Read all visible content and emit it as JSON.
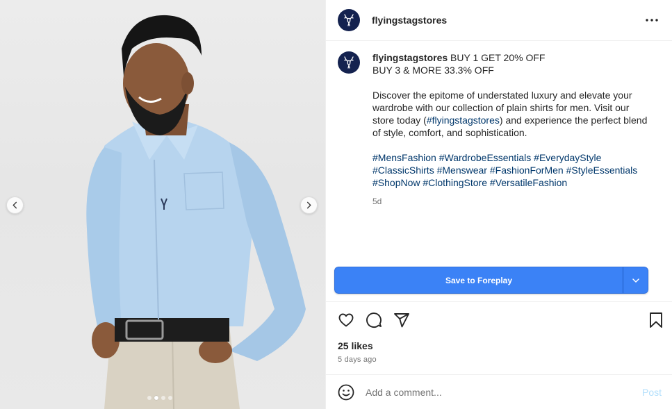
{
  "post": {
    "username": "flyingstagstores",
    "caption": {
      "line1": "BUY 1 GET 20% OFF",
      "line2": "BUY 3 & MORE 33.3% OFF",
      "body_before_tag": "Discover the epitome of understated luxury and elevate your wardrobe with our collection of plain shirts for men. Visit our store today (",
      "inline_tag": "#flyingstagstores",
      "body_after_tag": ") and experience the perfect blend of style, comfort, and sophistication.",
      "hashtags": [
        "#MensFashion",
        "#WardrobeEssentials",
        "#EverydayStyle",
        "#ClassicShirts",
        "#Menswear",
        "#FashionForMen",
        "#StyleEssentials",
        "#ShopNow",
        "#ClothingStore",
        "#VersatileFashion"
      ],
      "time_short": "5d"
    },
    "save_button_label": "Save to Foreplay",
    "likes": "25 likes",
    "posted_ago": "5 days ago",
    "comment_placeholder": "Add a comment...",
    "post_label": "Post",
    "carousel": {
      "total": 4,
      "active_index": 1
    }
  },
  "colors": {
    "brand_avatar": "#14224f",
    "save_button": "#3b82f6",
    "hashtag": "#00376b",
    "post_disabled": "#b2dffc"
  },
  "icons": {
    "avatar": "stag-logo-icon",
    "more": "more-horizontal-icon",
    "like": "heart-icon",
    "comment": "comment-bubble-icon",
    "share": "paper-plane-icon",
    "bookmark": "bookmark-icon",
    "emoji": "smiley-icon",
    "dropdown": "chevron-down-icon",
    "prev": "chevron-left-icon",
    "next": "chevron-right-icon"
  }
}
